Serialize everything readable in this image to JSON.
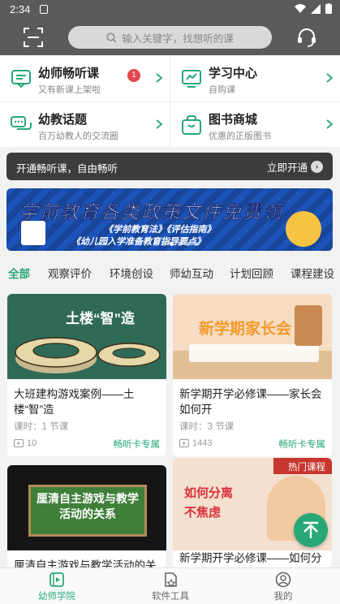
{
  "status_bar": {
    "time": "2:34"
  },
  "header": {
    "search_placeholder": "输入关键字，找想听的课",
    "icons": [
      "scan-icon",
      "search-icon",
      "headset-icon"
    ]
  },
  "quick_links": [
    {
      "title": "幼师畅听课",
      "subtitle": "又有新课上架啦",
      "badge": "1",
      "icon": "message-board-icon"
    },
    {
      "title": "学习中心",
      "subtitle": "自购课",
      "icon": "chart-monitor-icon"
    },
    {
      "title": "幼教话题",
      "subtitle": "百万幼教人的交流圈",
      "icon": "chat-bubbles-icon"
    },
    {
      "title": "图书商城",
      "subtitle": "优惠的正版图书",
      "icon": "bag-icon"
    }
  ],
  "membership": {
    "text": "开通畅听课，自由畅听",
    "action": "立即开通"
  },
  "banner": {
    "headline": "学前教育各类政策文件免费领",
    "line1": "《学前教育法》《评估指南》",
    "line2": "《幼儿园入学准备教育指导要点》",
    "slides": 6,
    "active_slide": 2
  },
  "tabs": [
    "全部",
    "观察评价",
    "环境创设",
    "师幼互动",
    "计划回顾",
    "课程建设"
  ],
  "active_tab": 0,
  "courses": [
    {
      "cover_text": "土楼“智”造",
      "title": "大班建构游戏案例——土楼“智”造",
      "lessons": "课时：1 节课",
      "views": "10",
      "tag": "畅听卡专属"
    },
    {
      "cover_text": "新学期家长会",
      "title": "新学期开学必修课——家长会如何开",
      "lessons": "课时：3 节课",
      "views": "1443",
      "tag": "畅听卡专属"
    },
    {
      "cover_text": "厘清自主游戏与教学活动的关系",
      "title": "厘清自主游戏与教学活动的关"
    },
    {
      "cover_text": "如何分离 不焦虑",
      "cover_badge": "热门课程",
      "title": "新学期开学必修课——如何分离"
    }
  ],
  "bottom_nav": [
    {
      "label": "幼师学院",
      "icon": "play-book-icon",
      "active": true
    },
    {
      "label": "软件工具",
      "icon": "tools-doc-icon",
      "active": false
    },
    {
      "label": "我的",
      "icon": "user-icon",
      "active": false
    }
  ],
  "colors": {
    "accent": "#27a876",
    "header": "#5a5a5a",
    "badge": "#e5484d"
  }
}
